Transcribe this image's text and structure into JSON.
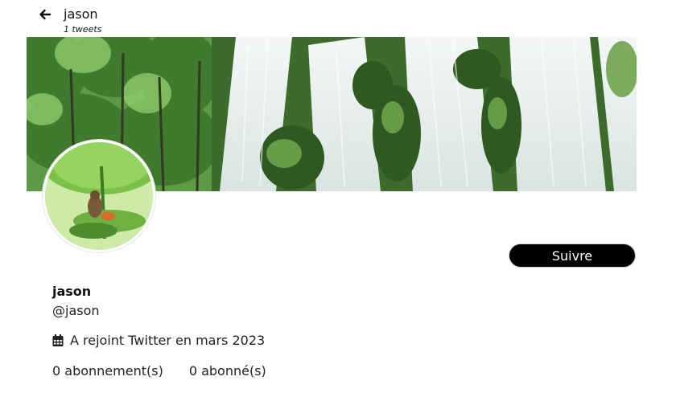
{
  "header": {
    "back_icon": "arrow-left-icon",
    "title": "jason",
    "tweet_count": "1 tweets"
  },
  "profile": {
    "banner": "waterfall-forest-photo",
    "avatar": "frog-on-leaf-photo",
    "follow_label": "Suivre",
    "name": "jason",
    "handle": "@jason",
    "calendar_icon": "calendar-icon",
    "joined": "A rejoint Twitter en mars 2023",
    "following": "0 abonnement(s)",
    "followers": "0 abonné(s)"
  },
  "colors": {
    "follow_button_bg": "#000000",
    "follow_button_text": "#ffffff",
    "background": "#ffffff"
  }
}
